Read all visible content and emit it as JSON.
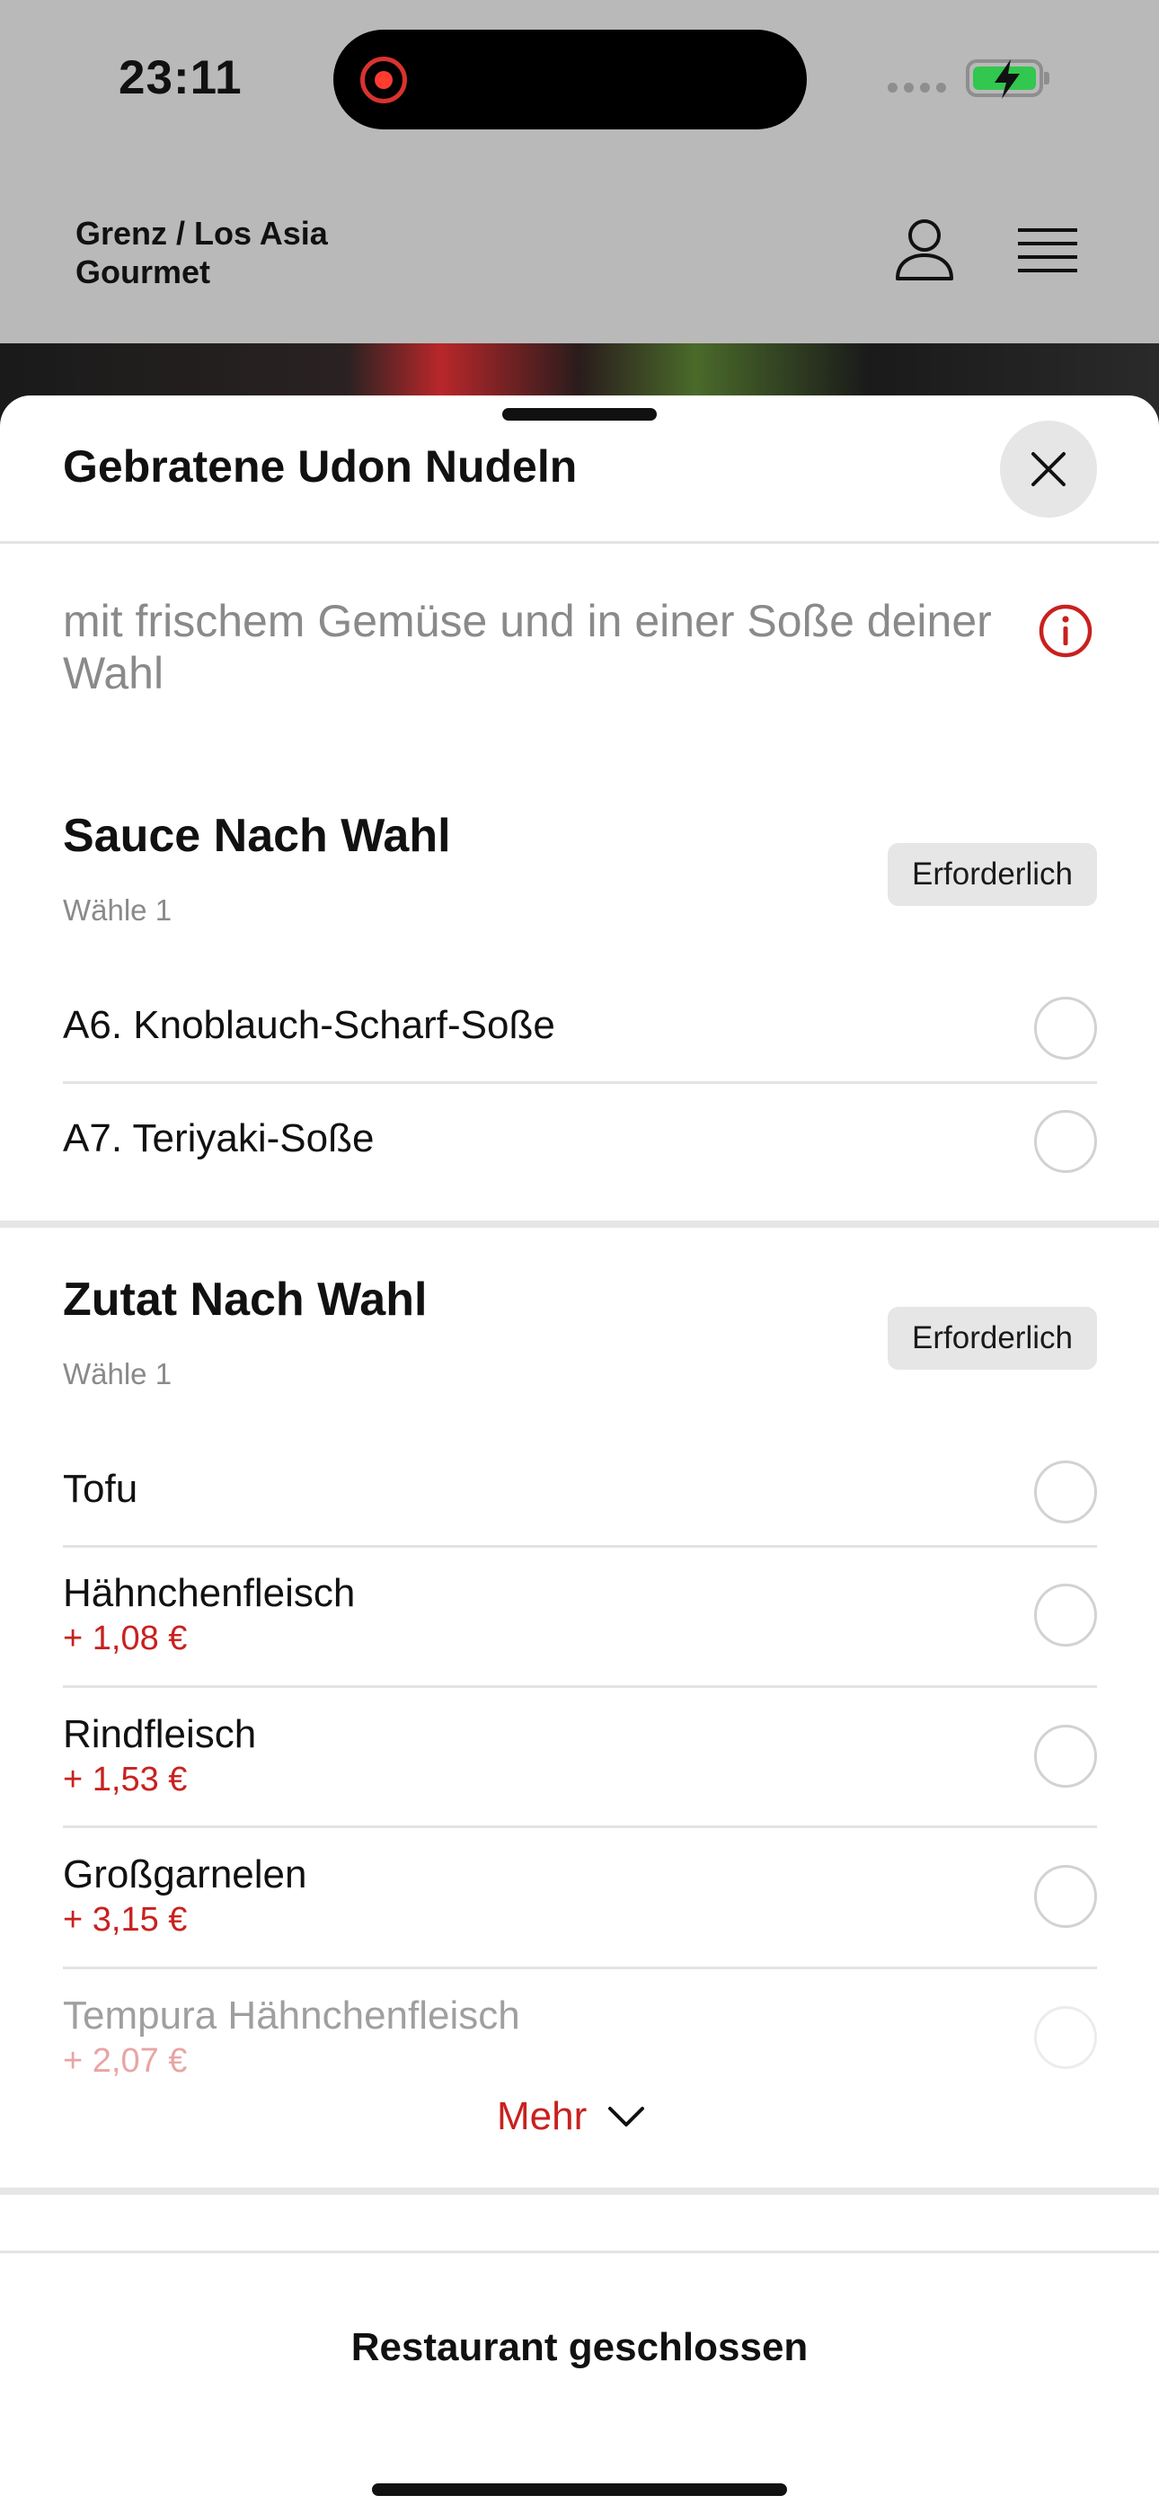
{
  "status_bar": {
    "time": "23:11",
    "battery_color": "#32c74e",
    "recording_color": "#ff3b30"
  },
  "header": {
    "brand_name": "Grenz / Los Asia Gourmet",
    "user_icon": "user-icon",
    "menu_icon": "hamburger-menu-icon"
  },
  "sheet": {
    "title": "Gebratene Udon Nudeln",
    "description": "mit frischem Gemüse und in einer Soße deiner Wahl",
    "groups": [
      {
        "title": "Sauce Nach Wahl",
        "subtitle": "Wähle 1",
        "badge": "Erforderlich",
        "options": [
          {
            "label": "A6. Knoblauch-Scharf-Soße",
            "price": ""
          },
          {
            "label": "A7. Teriyaki-Soße",
            "price": ""
          }
        ]
      },
      {
        "title": "Zutat Nach Wahl",
        "subtitle": "Wähle 1",
        "badge": "Erforderlich",
        "options": [
          {
            "label": "Tofu",
            "price": ""
          },
          {
            "label": "Hähnchenfleisch",
            "price": "+ 1,08 €"
          },
          {
            "label": "Rindfleisch",
            "price": "+ 1,53 €"
          },
          {
            "label": "Großgarnelen",
            "price": "+ 3,15 €"
          },
          {
            "label": "Tempura Hähnchenfleisch",
            "price": "+ 2,07 €"
          }
        ],
        "more_label": "Mehr"
      }
    ]
  },
  "footer": {
    "status_label": "Restaurant geschlossen"
  },
  "colors": {
    "accent": "#c8211f",
    "badge_bg": "#e6e6e6",
    "overlay": "#b9b9b9"
  }
}
